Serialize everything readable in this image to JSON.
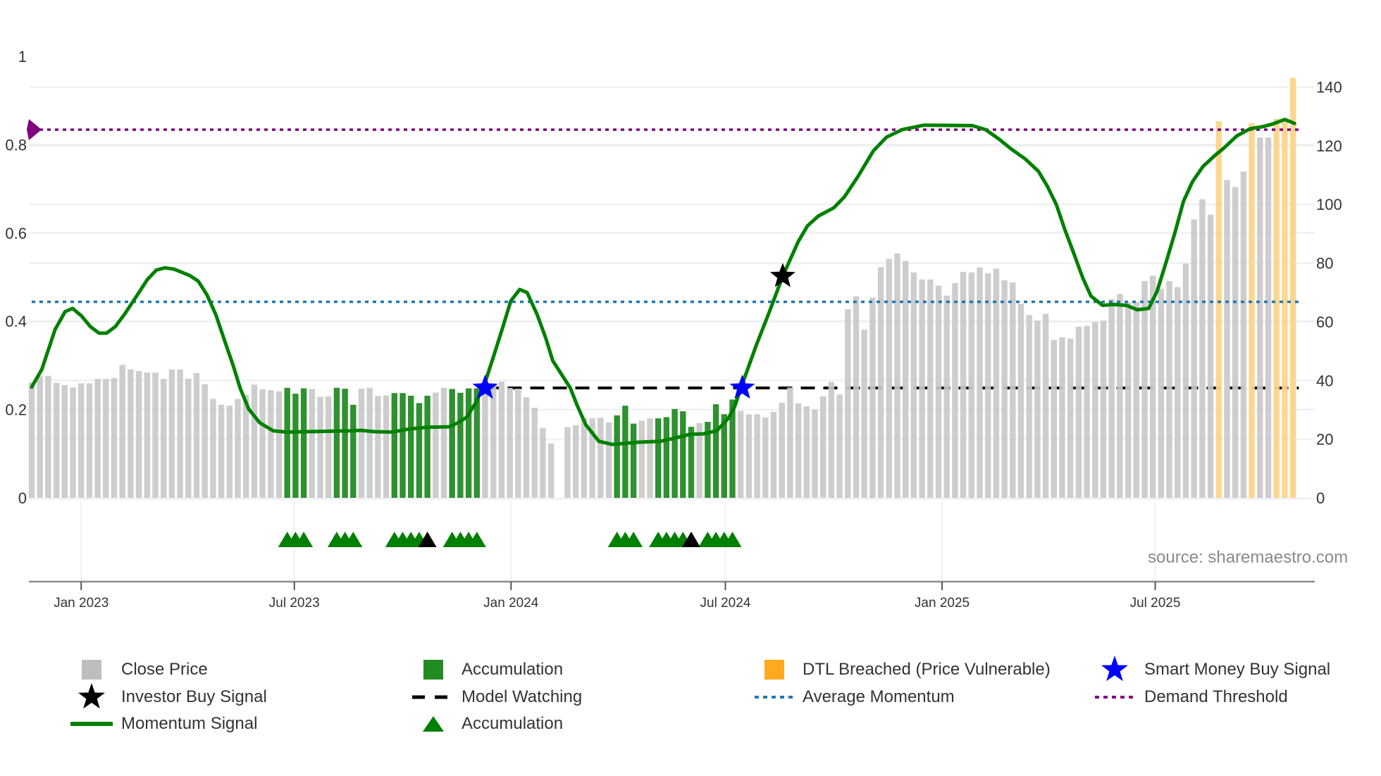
{
  "chart_data": {
    "type": "bar",
    "x_start_date": "2022-11-20",
    "x_interval_days": 7,
    "x_ticks": [
      {
        "date": "2023-01-01",
        "label": "Jan 2023"
      },
      {
        "date": "2023-07-01",
        "label": "Jul 2023"
      },
      {
        "date": "2024-01-01",
        "label": "Jan 2024"
      },
      {
        "date": "2024-07-01",
        "label": "Jul 2024"
      },
      {
        "date": "2025-01-01",
        "label": "Jan 2025"
      },
      {
        "date": "2025-07-01",
        "label": "Jul 2025"
      }
    ],
    "y_left": {
      "range": [
        0,
        1
      ],
      "ticks": [
        0,
        0.2,
        0.4,
        0.6,
        0.8,
        1
      ],
      "tick_labels": [
        "0",
        "0.2",
        "0.4",
        "0.6",
        "0.8",
        "1"
      ]
    },
    "y_right": {
      "range": [
        0,
        150
      ],
      "ticks": [
        0,
        20,
        40,
        60,
        80,
        100,
        120,
        140
      ],
      "tick_labels": [
        "0",
        "20",
        "40",
        "60",
        "80",
        "100",
        "120",
        "140"
      ]
    },
    "grid": true,
    "close_price": [
      39.4,
      41.4,
      41.6,
      39.2,
      38.4,
      37.6,
      39,
      39,
      40.5,
      40.5,
      40.8,
      45.3,
      43.8,
      43.2,
      42.7,
      42.7,
      40.5,
      43.7,
      43.7,
      40.6,
      42.5,
      38.7,
      33.7,
      31.7,
      31.4,
      33.7,
      35.1,
      38.6,
      37,
      36.7,
      36.3,
      37.5,
      35.5,
      37.3,
      37.1,
      34.4,
      34.6,
      37.5,
      37.2,
      31.7,
      37.2,
      37.5,
      34.7,
      34.9,
      35.7,
      35.7,
      34.8,
      32.3,
      34.8,
      35.9,
      37.5,
      37.1,
      35.8,
      37.3,
      37.3,
      37.5,
      38.7,
      39.6,
      37.5,
      37.2,
      34.3,
      30.7,
      23.8,
      18.5,
      null,
      24.1,
      24.7,
      27.3,
      27.1,
      27.3,
      25.7,
      28.1,
      31.4,
      25.3,
      26.3,
      27.1,
      27.1,
      27.5,
      30.3,
      29.5,
      24.2,
      25.5,
      25.9,
      31.9,
      28.5,
      33.5,
      29.6,
      28.5,
      28.5,
      27.4,
      29.3,
      32.4,
      37.6,
      32.2,
      31.2,
      30.1,
      34.6,
      39.5,
      35.2,
      64.3,
      68.7,
      57.3,
      68.2,
      78.6,
      81.4,
      83.3,
      80.7,
      76.8,
      74.4,
      74.4,
      72.3,
      68.9,
      73.2,
      77,
      76.8,
      78.5,
      76.5,
      78.1,
      74.1,
      73.4,
      66.1,
      62.3,
      60.4,
      62.7,
      53.8,
      54.7,
      54.3,
      58.3,
      58.6,
      59.9,
      60.4,
      67.7,
      69.5,
      66.6,
      66.8,
      73.9,
      75.7,
      71.3,
      73.9,
      71.8,
      79.8,
      94.9,
      101.7,
      96.5,
      128.3,
      108.3,
      105.9,
      111.2,
      127.7,
      122.8,
      122.8,
      129.1,
      129.1,
      143.1
    ],
    "accumulation_bar_weeks": [
      31,
      32,
      33,
      37,
      38,
      39,
      44,
      45,
      46,
      47,
      48,
      51,
      52,
      53,
      54,
      71,
      72,
      73,
      76,
      77,
      78,
      79,
      80,
      82,
      83,
      84,
      85
    ],
    "dtl_breached_weeks": [
      144,
      148,
      151,
      152,
      153
    ],
    "accumulation_marker_weeks": [
      31,
      32,
      33,
      37,
      38,
      39,
      44,
      45,
      46,
      47,
      51,
      52,
      53,
      54,
      71,
      72,
      73,
      76,
      77,
      78,
      79,
      82,
      83,
      84,
      85
    ],
    "accumulation_marker_black_weeks": [
      48,
      80
    ],
    "momentum_signal": [
      [
        0,
        0.251
      ],
      [
        1.23,
        0.291
      ],
      [
        2.83,
        0.381
      ],
      [
        4.06,
        0.422
      ],
      [
        4.97,
        0.429
      ],
      [
        6.04,
        0.412
      ],
      [
        7.1,
        0.388
      ],
      [
        8.17,
        0.373
      ],
      [
        9.08,
        0.373
      ],
      [
        10.15,
        0.388
      ],
      [
        11.38,
        0.419
      ],
      [
        12.72,
        0.457
      ],
      [
        14.05,
        0.495
      ],
      [
        15.12,
        0.516
      ],
      [
        16.18,
        0.521
      ],
      [
        17.26,
        0.518
      ],
      [
        19.13,
        0.504
      ],
      [
        20.2,
        0.491
      ],
      [
        21.26,
        0.46
      ],
      [
        22.33,
        0.415
      ],
      [
        23.4,
        0.356
      ],
      [
        24.47,
        0.298
      ],
      [
        25.27,
        0.249
      ],
      [
        26.33,
        0.201
      ],
      [
        27.67,
        0.17
      ],
      [
        29.27,
        0.152
      ],
      [
        30.88,
        0.149
      ],
      [
        33.55,
        0.15
      ],
      [
        38.89,
        0.152
      ],
      [
        39.96,
        0.153
      ],
      [
        41.56,
        0.15
      ],
      [
        43.7,
        0.149
      ],
      [
        45.84,
        0.156
      ],
      [
        47.97,
        0.16
      ],
      [
        50.64,
        0.161
      ],
      [
        51.7,
        0.17
      ],
      [
        52.78,
        0.183
      ],
      [
        53.85,
        0.215
      ],
      [
        54.91,
        0.256
      ],
      [
        55.98,
        0.318
      ],
      [
        57.05,
        0.381
      ],
      [
        58.12,
        0.446
      ],
      [
        59.19,
        0.472
      ],
      [
        60.09,
        0.465
      ],
      [
        61.32,
        0.415
      ],
      [
        62.39,
        0.36
      ],
      [
        63.2,
        0.311
      ],
      [
        64.26,
        0.28
      ],
      [
        65.33,
        0.249
      ],
      [
        66.14,
        0.211
      ],
      [
        67.2,
        0.166
      ],
      [
        68.8,
        0.128
      ],
      [
        70.4,
        0.121
      ],
      [
        73.6,
        0.126
      ],
      [
        76.3,
        0.128
      ],
      [
        77.9,
        0.135
      ],
      [
        79.9,
        0.144
      ],
      [
        81.5,
        0.145
      ],
      [
        83.1,
        0.152
      ],
      [
        84.5,
        0.18
      ],
      [
        85.3,
        0.208
      ],
      [
        86.3,
        0.263
      ],
      [
        87.9,
        0.346
      ],
      [
        89.5,
        0.422
      ],
      [
        91.1,
        0.502
      ],
      [
        93.0,
        0.581
      ],
      [
        94.1,
        0.616
      ],
      [
        95.4,
        0.638
      ],
      [
        97.3,
        0.657
      ],
      [
        98.6,
        0.682
      ],
      [
        100.2,
        0.727
      ],
      [
        102.1,
        0.786
      ],
      [
        103.7,
        0.817
      ],
      [
        105.6,
        0.834
      ],
      [
        108.2,
        0.844
      ],
      [
        114.1,
        0.843
      ],
      [
        115.7,
        0.834
      ],
      [
        117.3,
        0.813
      ],
      [
        118.9,
        0.789
      ],
      [
        120.5,
        0.768
      ],
      [
        122.1,
        0.74
      ],
      [
        123.2,
        0.706
      ],
      [
        124.3,
        0.664
      ],
      [
        125.3,
        0.609
      ],
      [
        126.4,
        0.554
      ],
      [
        127.5,
        0.498
      ],
      [
        128.5,
        0.457
      ],
      [
        129.9,
        0.436
      ],
      [
        131.2,
        0.438
      ],
      [
        132.8,
        0.436
      ],
      [
        134.1,
        0.426
      ],
      [
        135.5,
        0.429
      ],
      [
        136.5,
        0.467
      ],
      [
        137.6,
        0.533
      ],
      [
        138.7,
        0.602
      ],
      [
        139.7,
        0.671
      ],
      [
        140.8,
        0.716
      ],
      [
        142.1,
        0.751
      ],
      [
        143.5,
        0.775
      ],
      [
        144.6,
        0.792
      ],
      [
        146.2,
        0.82
      ],
      [
        147.8,
        0.836
      ],
      [
        149.4,
        0.841
      ],
      [
        150.4,
        0.846
      ],
      [
        152.0,
        0.857
      ],
      [
        153.2,
        0.848
      ]
    ],
    "average_momentum": 0.444,
    "demand_threshold": 0.834,
    "model_watching": {
      "value": 0.249,
      "from_week": 55,
      "to_week": 153.7
    },
    "smart_money_buy_signals": [
      [
        55.0,
        0.249
      ],
      [
        86.2,
        0.249
      ]
    ],
    "investor_buy_signals": [
      [
        91.1,
        0.502
      ]
    ],
    "colors": {
      "close_price": "#c9c9c9",
      "close_price_legend": "#bdbdbd",
      "accumulation": "#2f912f",
      "accumulation_legend": "#228b22",
      "dtl_breached": "#fdd48a",
      "dtl_legend": "#ffa91f",
      "momentum": "#008000",
      "average_momentum": "#1f77b4",
      "demand_threshold": "#800080",
      "model_watching": "#000000",
      "smart_money": "#0000ff",
      "investor": "#000000",
      "marker_green": "#008000"
    },
    "legend_placement": "bottom"
  },
  "legend": {
    "close_price": "Close Price",
    "accumulation_bar": "Accumulation",
    "dtl_breached": "DTL Breached (Price Vulnerable)",
    "smart_money": "Smart Money Buy Signal",
    "investor": "Investor Buy Signal",
    "model_watching": "Model Watching",
    "average_momentum": "Average Momentum",
    "demand_threshold": "Demand Threshold",
    "momentum": "Momentum Signal",
    "accumulation_marker": "Accumulation"
  },
  "source": "source: sharemaestro.com"
}
